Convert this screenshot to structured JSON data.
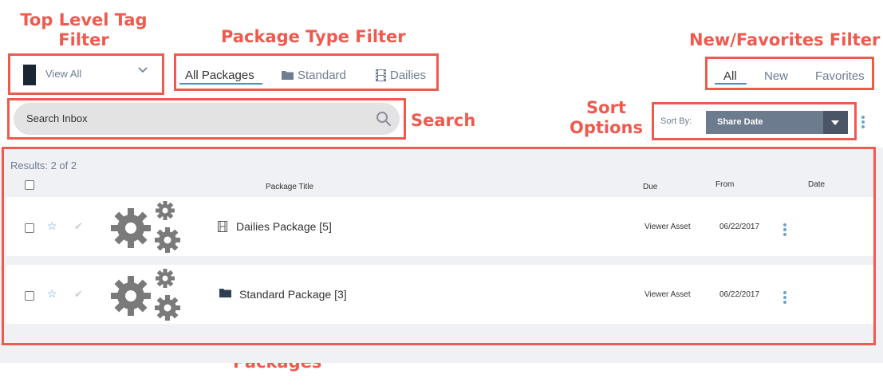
{
  "annotations": {
    "tag_filter_line1": "Top Level Tag",
    "tag_filter_line2": "Filter",
    "package_type_filter": "Package Type Filter",
    "new_fav_filter": "New/Favorites Filter",
    "search": "Search",
    "sort_line1": "Sort",
    "sort_line2": "Options",
    "packages": "Packages",
    "color": "#ef5a4e"
  },
  "tag_filter": {
    "selected": "View All",
    "swatch_color": "#1a2633"
  },
  "package_type_tabs": [
    "All Packages",
    "Standard",
    "Dailies"
  ],
  "new_fav_tabs": [
    "All",
    "New",
    "Favorites"
  ],
  "search": {
    "placeholder": "Search Inbox"
  },
  "sort": {
    "label": "Sort By:",
    "value": "Share Date"
  },
  "results": {
    "summary": "Results: 2 of 2",
    "columns": {
      "title": "Package Title",
      "due": "Due",
      "from": "From",
      "date": "Date"
    },
    "rows": [
      {
        "type_icon": "film-icon",
        "title": "Dailies Package [5]",
        "due": "Viewer Asset",
        "from": "06/22/2017"
      },
      {
        "type_icon": "folder-icon",
        "title": "Standard Package [3]",
        "due": "Viewer Asset",
        "from": "06/22/2017"
      }
    ]
  }
}
